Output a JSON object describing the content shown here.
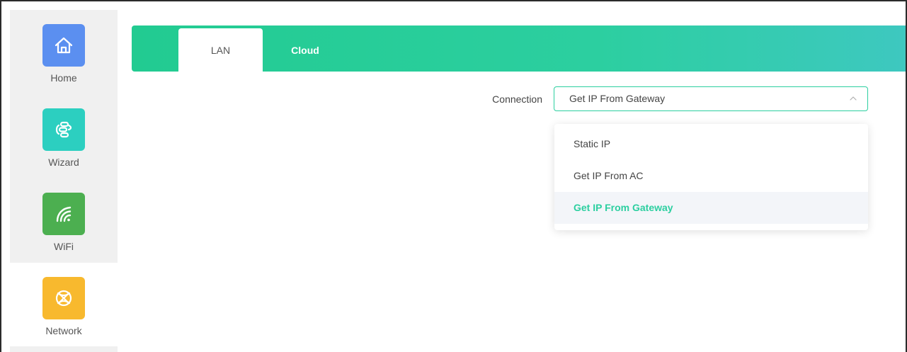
{
  "sidebar": {
    "items": [
      {
        "label": "Home",
        "icon": "home-icon",
        "color": "#5b8ff0"
      },
      {
        "label": "Wizard",
        "icon": "wizard-icon",
        "color": "#2ccfc0"
      },
      {
        "label": "WiFi",
        "icon": "wifi-icon",
        "color": "#4caf50"
      },
      {
        "label": "Network",
        "icon": "network-icon",
        "color": "#f8b92e"
      }
    ],
    "active": "Network"
  },
  "tabs": [
    {
      "label": "LAN",
      "active": true
    },
    {
      "label": "Cloud",
      "active": false
    }
  ],
  "form": {
    "connection_label": "Connection",
    "connection_value": "Get IP From Gateway",
    "options": [
      {
        "label": "Static IP",
        "selected": false
      },
      {
        "label": "Get IP From AC",
        "selected": false
      },
      {
        "label": "Get IP From Gateway",
        "selected": true
      }
    ]
  },
  "colors": {
    "accent": "#2ccfa0",
    "tabbar_start": "#22cb91",
    "tabbar_end": "#3ec8c0"
  }
}
